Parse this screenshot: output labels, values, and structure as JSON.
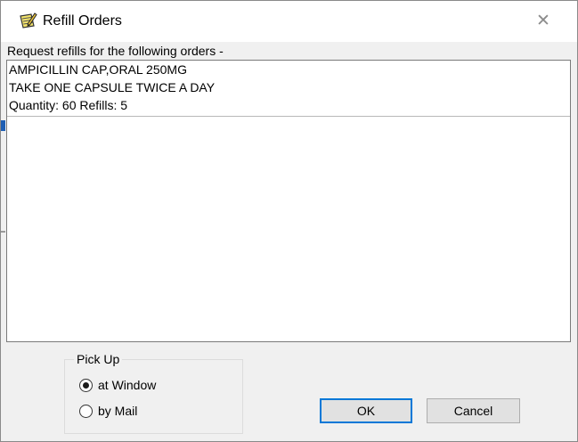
{
  "window": {
    "title": "Refill Orders",
    "close_glyph": "✕"
  },
  "request_label": "Request refills for the following orders -",
  "orders": [
    {
      "drug": "AMPICILLIN CAP,ORAL 250MG",
      "sig": "TAKE ONE CAPSULE TWICE A DAY",
      "quantity_refills": "Quantity: 60  Refills: 5"
    }
  ],
  "pickup": {
    "legend": "Pick Up",
    "options": [
      {
        "label": "at Window",
        "selected": true
      },
      {
        "label": "by Mail",
        "selected": false
      }
    ]
  },
  "buttons": {
    "ok": "OK",
    "cancel": "Cancel"
  },
  "icons": {
    "title": "notepad-pencil-icon",
    "close": "close-icon"
  },
  "colors": {
    "focus_border": "#0078d7",
    "window_bg": "#f0f0f0"
  }
}
